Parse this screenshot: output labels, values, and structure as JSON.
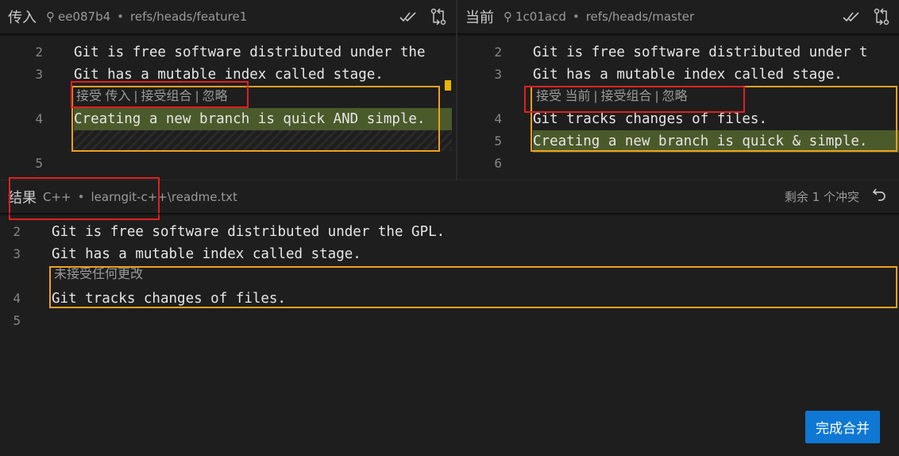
{
  "incoming": {
    "title": "传入",
    "commit": "ee087b4",
    "ref": "refs/heads/feature1",
    "lines": [
      {
        "num": "2",
        "text": "Git is free software distributed under the"
      },
      {
        "num": "3",
        "text": "Git has a mutable index called stage."
      },
      {
        "num": "4",
        "text": "Creating a new branch is quick AND simple."
      },
      {
        "num": "5",
        "text": ""
      }
    ],
    "codelens": {
      "accept": "接受 传入",
      "combine": "接受组合",
      "ignore": "忽略",
      "sep": "|"
    }
  },
  "current": {
    "title": "当前",
    "commit": "1c01acd",
    "ref": "refs/heads/master",
    "lines": [
      {
        "num": "2",
        "text": "Git is free software distributed under t"
      },
      {
        "num": "3",
        "text": "Git has a mutable index called stage."
      },
      {
        "num": "4",
        "text": "Git tracks changes of files."
      },
      {
        "num": "5",
        "text": "Creating a new branch is quick & simple."
      },
      {
        "num": "6",
        "text": ""
      }
    ],
    "codelens": {
      "accept": "接受 当前",
      "combine": "接受组合",
      "ignore": "忽略",
      "sep": "|"
    }
  },
  "result": {
    "title": "结果",
    "language": "C++",
    "path": "learngit-c++\\readme.txt",
    "conflicts": "剩余 1 个冲突",
    "no_changes": "未接受任何更改",
    "lines": [
      {
        "num": "2",
        "text": "Git is free software distributed under the GPL."
      },
      {
        "num": "3",
        "text": "Git has a mutable index called stage."
      },
      {
        "num": "4",
        "text": "Git tracks changes of files."
      },
      {
        "num": "5",
        "text": ""
      }
    ]
  },
  "sep_dot": "•",
  "complete_button": "完成合并",
  "colors": {
    "accent": "#0e78d4",
    "orange_box": "#f0a020",
    "red_box": "#e02020",
    "green_hl": "#4b5a2a"
  }
}
